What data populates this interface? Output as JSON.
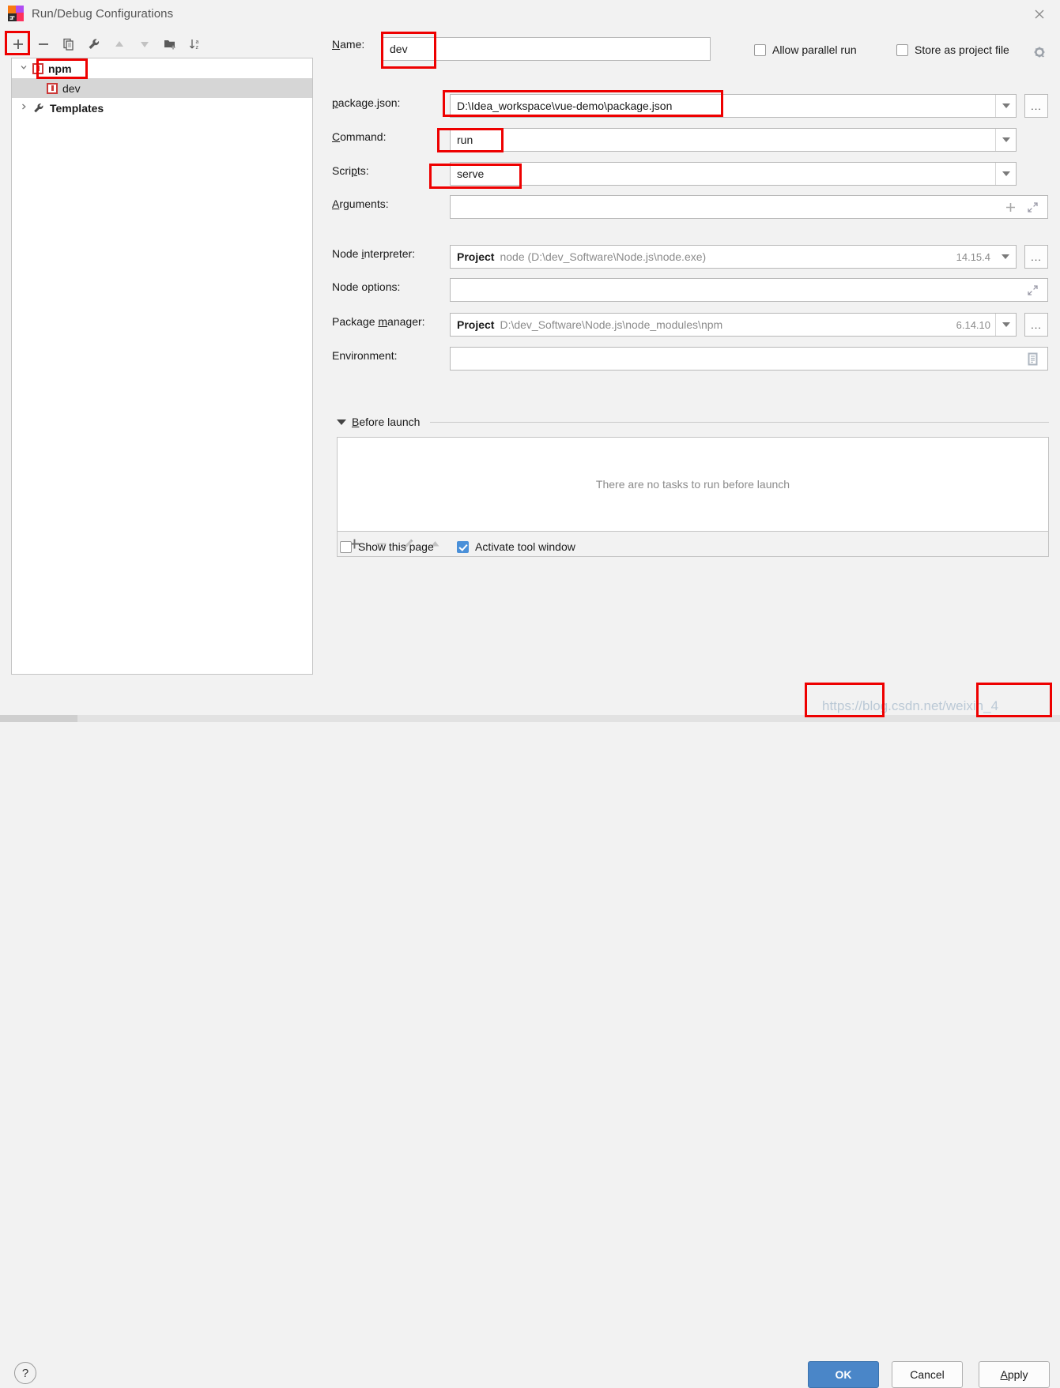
{
  "window": {
    "title": "Run/Debug Configurations",
    "app_icon": "intellij-idea-logo",
    "close_icon": "close-icon"
  },
  "tree_toolbar": {
    "buttons": [
      {
        "name": "add-configuration",
        "icon": "plus-icon",
        "label": "+"
      },
      {
        "name": "remove-configuration",
        "icon": "minus-icon",
        "label": "−"
      },
      {
        "name": "copy-configuration",
        "icon": "copy-icon",
        "label": "copy"
      },
      {
        "name": "edit-templates",
        "icon": "wrench-icon",
        "label": "wrench"
      },
      {
        "name": "move-up",
        "icon": "arrow-up-icon",
        "label": "up"
      },
      {
        "name": "move-down",
        "icon": "arrow-down-icon",
        "label": "down"
      },
      {
        "name": "new-folder",
        "icon": "folder-add-icon",
        "label": "folder"
      },
      {
        "name": "sort-alphabetically",
        "icon": "sort-az-icon",
        "label": "sort"
      }
    ]
  },
  "tree": {
    "nodes": [
      {
        "label": "npm",
        "icon": "npm-icon",
        "expanded": true,
        "bold": true,
        "indent": 0,
        "selected": false,
        "chevron": "chevron-down-icon"
      },
      {
        "label": "dev",
        "icon": "npm-icon",
        "expanded": false,
        "bold": false,
        "indent": 1,
        "selected": true,
        "chevron": ""
      },
      {
        "label": "Templates",
        "icon": "wrench-icon",
        "expanded": false,
        "bold": true,
        "indent": 0,
        "selected": false,
        "chevron": "chevron-right-icon"
      }
    ]
  },
  "form": {
    "name_label": "Name:",
    "name_value": "dev",
    "allow_parallel_run": {
      "label": "Allow parallel run",
      "checked": false
    },
    "store_as_project_file": {
      "label": "Store as project file",
      "checked": false
    },
    "gear_icon": "gear-dropdown-icon",
    "package_json_label": "package.json:",
    "package_json_value": "D:\\Idea_workspace\\vue-demo\\package.json",
    "command_label": "Command:",
    "command_value": "run",
    "scripts_label": "Scripts:",
    "scripts_value": "serve",
    "arguments_label": "Arguments:",
    "arguments_value": "",
    "node_interpreter_label": "Node interpreter:",
    "node_interpreter_scope": "Project",
    "node_interpreter_value": "node (D:\\dev_Software\\Node.js\\node.exe)",
    "node_interpreter_version": "14.15.4",
    "node_options_label": "Node options:",
    "node_options_value": "",
    "package_manager_label": "Package manager:",
    "package_manager_scope": "Project",
    "package_manager_value": "D:\\dev_Software\\Node.js\\node_modules\\npm",
    "package_manager_version": "6.14.10",
    "environment_label": "Environment:",
    "environment_value": "",
    "browse_button_label": "...",
    "before_launch": {
      "title": "Before launch",
      "empty_text": "There are no tasks to run before launch",
      "toolbar": [
        {
          "name": "add-task",
          "icon": "plus-icon"
        },
        {
          "name": "remove-task",
          "icon": "minus-icon"
        },
        {
          "name": "edit-task",
          "icon": "pencil-icon"
        },
        {
          "name": "move-task-up",
          "icon": "arrow-up-icon"
        },
        {
          "name": "move-task-down",
          "icon": "arrow-down-icon"
        }
      ]
    },
    "show_this_page": {
      "label": "Show this page",
      "checked": false
    },
    "activate_tool_window": {
      "label": "Activate tool window",
      "checked": true
    }
  },
  "footer": {
    "help_label": "?",
    "ok_label": "OK",
    "cancel_label": "Cancel",
    "apply_label": "Apply"
  },
  "watermark": "https://blog.csdn.net/weixin_4",
  "colors": {
    "annotation": "#ee0000",
    "primary_button": "#4a86c8",
    "checkbox_checked": "#4a90d9",
    "npm_red": "#cb3837"
  }
}
